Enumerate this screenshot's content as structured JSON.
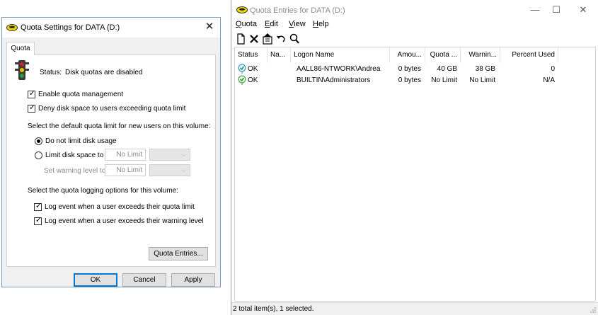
{
  "settings_dialog": {
    "title": "Quota Settings for DATA (D:)",
    "close_glyph": "✕",
    "tab_label": "Quota",
    "status_label": "Status:",
    "status_value": "Disk quotas are disabled",
    "enable_quota_label": "Enable quota management",
    "enable_quota_checked": true,
    "deny_space_label": "Deny disk space to users exceeding quota limit",
    "deny_space_checked": true,
    "default_limit_heading": "Select the default quota limit for new users on this volume:",
    "no_limit_option": "Do not limit disk usage",
    "limit_option": "Limit disk space to",
    "limit_value": "No Limit",
    "warning_label": "Set warning level to",
    "warning_value": "No Limit",
    "logging_heading": "Select the quota logging options for this volume:",
    "log_exceed_limit_label": "Log event when a user exceeds their quota limit",
    "log_exceed_limit_checked": true,
    "log_exceed_warning_label": "Log event when a user exceeds their warning level",
    "log_exceed_warning_checked": true,
    "quota_entries_button": "Quota Entries...",
    "ok_button": "OK",
    "cancel_button": "Cancel",
    "apply_button": "Apply"
  },
  "entries_window": {
    "title": "Quota Entries for DATA (D:)",
    "minimize_glyph": "—",
    "maximize_glyph": "☐",
    "close_glyph": "✕",
    "menu": {
      "quota_rest": "uota",
      "quota_key": "Q",
      "edit_rest": "dit",
      "edit_key": "E",
      "view_rest": "iew",
      "view_key": "V",
      "help_rest": "elp",
      "help_key": "H"
    },
    "columns": {
      "status": "Status",
      "name": "Na...",
      "logon": "Logon Name",
      "amount": "Amou...",
      "quota": "Quota ...",
      "warning": "Warnin...",
      "percent": "Percent Used"
    },
    "rows": [
      {
        "status": "OK",
        "name": "",
        "logon": "AALL86-NTWORK\\Andrea",
        "amount": "0 bytes",
        "quota": "40 GB",
        "warning": "38 GB",
        "percent": "0"
      },
      {
        "status": "OK",
        "name": "",
        "logon": "BUILTIN\\Administrators",
        "amount": "0 bytes",
        "quota": "No Limit",
        "warning": "No Limit",
        "percent": "N/A"
      }
    ],
    "status_text": "2 total item(s), 1 selected."
  },
  "icons": {
    "app_icon": "disk-drive-icon",
    "traffic_light": "traffic-light-icon",
    "status_ok": "status-ok-icon"
  },
  "colors": {
    "accent_blue": "#0078d7",
    "dialog_bg": "#f0f0f0",
    "ok_icon_green": "#3a9a3a",
    "traffic_red": "#d32020",
    "traffic_yellow": "#e8c200",
    "traffic_green": "#1ea03a"
  }
}
